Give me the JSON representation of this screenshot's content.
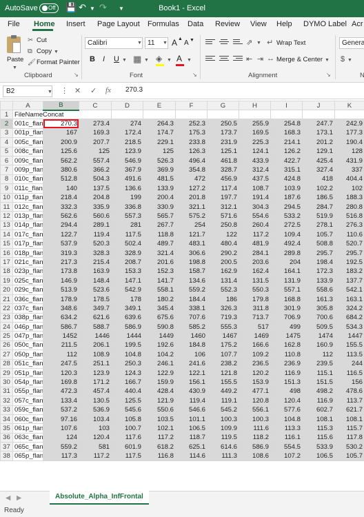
{
  "titlebar": {
    "autosave_label": "AutoSave",
    "autosave_state": "Off",
    "title": "Book1 - Excel"
  },
  "menu": [
    "File",
    "Home",
    "Insert",
    "Page Layout",
    "Formulas",
    "Data",
    "Review",
    "View",
    "Help",
    "DYMO Label",
    "Acr"
  ],
  "ribbon": {
    "paste": "Paste",
    "cut": "Cut",
    "copy": "Copy",
    "format_painter": "Format Painter",
    "clipboard_label": "Clipboard",
    "font_name": "Calibri",
    "font_size": "11",
    "bold": "B",
    "italic": "I",
    "underline": "U",
    "grow_font": "A",
    "shrink_font": "A",
    "font_color_letter": "A",
    "font_label": "Font",
    "wrap_text": "Wrap Text",
    "merge_center": "Merge & Center",
    "alignment_label": "Alignment",
    "number_format": "General"
  },
  "formula_bar": {
    "name_box": "B2",
    "fx": "fx",
    "value": "270.3"
  },
  "columns": [
    "A",
    "B",
    "C",
    "D",
    "E",
    "F",
    "G",
    "H",
    "I",
    "J",
    "K"
  ],
  "header_cell": "FileNameConcat",
  "rows": [
    {
      "n": "2",
      "name": "001c_flan",
      "v": [
        "270.3",
        "273.4",
        "274",
        "264.3",
        "252.3",
        "250.5",
        "255.9",
        "254.8",
        "247.7",
        "242.9"
      ]
    },
    {
      "n": "3",
      "name": "001p_flan",
      "v": [
        "167",
        "169.3",
        "172.4",
        "174.7",
        "175.3",
        "173.7",
        "169.5",
        "168.3",
        "173.1",
        "177.3"
      ]
    },
    {
      "n": "4",
      "name": "005c_flan",
      "v": [
        "200.9",
        "207.7",
        "218.5",
        "229.1",
        "233.8",
        "231.9",
        "225.3",
        "214.1",
        "201.2",
        "190.4"
      ]
    },
    {
      "n": "5",
      "name": "008c_flan",
      "v": [
        "125.6",
        "125",
        "123.9",
        "125",
        "126.3",
        "125.1",
        "124.1",
        "126.2",
        "129.1",
        "128"
      ]
    },
    {
      "n": "6",
      "name": "009c_flan",
      "v": [
        "562.2",
        "557.4",
        "546.9",
        "526.3",
        "496.4",
        "461.8",
        "433.9",
        "422.7",
        "425.4",
        "431.9"
      ]
    },
    {
      "n": "7",
      "name": "009p_flan",
      "v": [
        "380.6",
        "366.2",
        "367.9",
        "369.9",
        "354.8",
        "328.7",
        "312.4",
        "315.1",
        "327.4",
        "337"
      ]
    },
    {
      "n": "8",
      "name": "010c_flan",
      "v": [
        "512.8",
        "504.3",
        "491.6",
        "481.5",
        "472",
        "456.9",
        "437.5",
        "424.8",
        "418",
        "404.4"
      ]
    },
    {
      "n": "9",
      "name": "011c_flan",
      "v": [
        "140",
        "137.5",
        "136.6",
        "133.9",
        "127.2",
        "117.4",
        "108.7",
        "103.9",
        "102.2",
        "102"
      ]
    },
    {
      "n": "10",
      "name": "011p_flan",
      "v": [
        "218.4",
        "204.8",
        "199",
        "200.4",
        "201.8",
        "197.7",
        "191.4",
        "187.6",
        "186.5",
        "188.3"
      ]
    },
    {
      "n": "11",
      "name": "012c_flan",
      "v": [
        "332.3",
        "335.9",
        "336.8",
        "330.9",
        "321.1",
        "312.1",
        "304.3",
        "294.5",
        "284.7",
        "280.8"
      ]
    },
    {
      "n": "12",
      "name": "013p_flan",
      "v": [
        "562.6",
        "560.6",
        "557.3",
        "565.7",
        "575.2",
        "571.6",
        "554.6",
        "533.2",
        "519.9",
        "516.8"
      ]
    },
    {
      "n": "13",
      "name": "014p_flan",
      "v": [
        "294.4",
        "289.1",
        "281",
        "267.7",
        "254",
        "250.8",
        "260.4",
        "272.5",
        "278.1",
        "276.3"
      ]
    },
    {
      "n": "14",
      "name": "017c_flan",
      "v": [
        "122.7",
        "119.4",
        "117.5",
        "118.8",
        "121.7",
        "122",
        "117.2",
        "109.4",
        "105.7",
        "110.6"
      ]
    },
    {
      "n": "15",
      "name": "017p_flan",
      "v": [
        "537.9",
        "520.3",
        "502.4",
        "489.7",
        "483.1",
        "480.4",
        "481.9",
        "492.4",
        "508.8",
        "520.7"
      ]
    },
    {
      "n": "16",
      "name": "018p_flan",
      "v": [
        "319.3",
        "328.3",
        "328.9",
        "321.4",
        "306.6",
        "290.2",
        "284.1",
        "289.8",
        "295.7",
        "295.7"
      ]
    },
    {
      "n": "17",
      "name": "021c_flan",
      "v": [
        "217.3",
        "215.4",
        "208.7",
        "201.6",
        "198.8",
        "200.5",
        "203.6",
        "204",
        "198.4",
        "192.5"
      ]
    },
    {
      "n": "18",
      "name": "023p_flan",
      "v": [
        "173.8",
        "163.9",
        "153.3",
        "152.3",
        "158.7",
        "162.9",
        "162.4",
        "164.1",
        "172.3",
        "183.2"
      ]
    },
    {
      "n": "19",
      "name": "025c_flan",
      "v": [
        "146.9",
        "148.4",
        "147.1",
        "141.7",
        "134.6",
        "131.4",
        "131.5",
        "131.9",
        "133.9",
        "137.7"
      ]
    },
    {
      "n": "20",
      "name": "029c_flan",
      "v": [
        "513.9",
        "523.6",
        "542.9",
        "558.1",
        "559.2",
        "552.3",
        "550.3",
        "557.1",
        "558.6",
        "542.1"
      ]
    },
    {
      "n": "21",
      "name": "036c_flan",
      "v": [
        "178.9",
        "178.5",
        "178",
        "180.2",
        "184.4",
        "186",
        "179.8",
        "168.8",
        "161.3",
        "163.1"
      ]
    },
    {
      "n": "22",
      "name": "037c_flan",
      "v": [
        "348.6",
        "349.7",
        "349.1",
        "345.4",
        "338.1",
        "326.3",
        "311.8",
        "301.9",
        "305.8",
        "324.2"
      ]
    },
    {
      "n": "23",
      "name": "038p_flan",
      "v": [
        "634.2",
        "621.6",
        "639.6",
        "675.6",
        "707.6",
        "719.3",
        "713.7",
        "706.9",
        "700.6",
        "684.2"
      ]
    },
    {
      "n": "24",
      "name": "046p_flan",
      "v": [
        "586.7",
        "588.7",
        "586.9",
        "590.8",
        "585.2",
        "555.3",
        "517",
        "499",
        "509.5",
        "534.3"
      ]
    },
    {
      "n": "25",
      "name": "047p_flan",
      "v": [
        "1452",
        "1446",
        "1444",
        "1449",
        "1460",
        "1467",
        "1469",
        "1475",
        "1474",
        "1447"
      ]
    },
    {
      "n": "26",
      "name": "050c_flan",
      "v": [
        "211.5",
        "206.1",
        "199.5",
        "192.6",
        "184.8",
        "175.2",
        "166.6",
        "162.8",
        "160.9",
        "155.5"
      ]
    },
    {
      "n": "27",
      "name": "050p_flan",
      "v": [
        "112",
        "108.9",
        "104.8",
        "104.2",
        "106",
        "107.7",
        "109.2",
        "110.8",
        "112",
        "113.5"
      ]
    },
    {
      "n": "28",
      "name": "051c_flan",
      "v": [
        "247.5",
        "251.1",
        "250.3",
        "246.1",
        "241.6",
        "238.2",
        "236.5",
        "236.9",
        "239.5",
        "244"
      ]
    },
    {
      "n": "29",
      "name": "051p_flan",
      "v": [
        "120.3",
        "123.9",
        "124.3",
        "122.9",
        "122.1",
        "121.8",
        "120.2",
        "116.9",
        "115.1",
        "116.5"
      ]
    },
    {
      "n": "30",
      "name": "054p_flan",
      "v": [
        "169.8",
        "171.2",
        "166.7",
        "159.9",
        "156.1",
        "155.5",
        "153.9",
        "151.3",
        "151.5",
        "156"
      ]
    },
    {
      "n": "31",
      "name": "055p_flan",
      "v": [
        "472.3",
        "457.4",
        "440.4",
        "428.4",
        "430.9",
        "449.2",
        "477.1",
        "498",
        "498.2",
        "478.6"
      ]
    },
    {
      "n": "32",
      "name": "057c_flan",
      "v": [
        "133.4",
        "130.5",
        "125.5",
        "121.9",
        "119.4",
        "119.1",
        "120.8",
        "120.4",
        "116.9",
        "113.7"
      ]
    },
    {
      "n": "33",
      "name": "059c_flan",
      "v": [
        "537.2",
        "536.9",
        "545.6",
        "550.6",
        "546.6",
        "545.2",
        "556.1",
        "577.6",
        "602.7",
        "621.7"
      ]
    },
    {
      "n": "34",
      "name": "060c_flan",
      "v": [
        "97.16",
        "103.4",
        "105.8",
        "103.5",
        "101.1",
        "100.3",
        "100.3",
        "104.8",
        "108.1",
        "108.1"
      ]
    },
    {
      "n": "35",
      "name": "061p_flan",
      "v": [
        "107.6",
        "103",
        "100.7",
        "102.1",
        "106.5",
        "109.9",
        "111.6",
        "113.3",
        "115.3",
        "115.7"
      ]
    },
    {
      "n": "36",
      "name": "063c_flan",
      "v": [
        "124",
        "120.4",
        "117.6",
        "117.2",
        "118.7",
        "119.5",
        "118.2",
        "116.1",
        "115.6",
        "117.8"
      ]
    },
    {
      "n": "37",
      "name": "065c_flan",
      "v": [
        "559.2",
        "581",
        "601.9",
        "618.2",
        "625.1",
        "614.6",
        "586.9",
        "554.5",
        "533.9",
        "530.2"
      ]
    },
    {
      "n": "38",
      "name": "065p_flan",
      "v": [
        "117.3",
        "117.2",
        "117.5",
        "116.8",
        "114.6",
        "111.3",
        "108.6",
        "107.2",
        "106.5",
        "105.7"
      ]
    }
  ],
  "sheet_tab": "Absolute_Alpha_InfFrontal",
  "status": "Ready",
  "colors": {
    "accent": "#217346",
    "highlight": "#e81123"
  }
}
